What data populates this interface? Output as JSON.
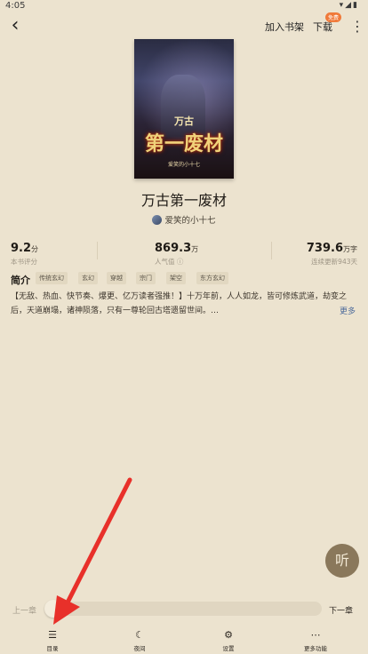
{
  "status_bar": {
    "time": "4:05",
    "icons": "▾◢▮"
  },
  "header": {
    "add_shelf": "加入书架",
    "download": "下载",
    "download_badge": "免费"
  },
  "book": {
    "cover_line1": "万古",
    "cover_line2": "第一废材",
    "cover_line3": "爱笑的小十七",
    "title": "万古第一废材",
    "author": "爱笑的小十七"
  },
  "stats": [
    {
      "value": "9.2",
      "unit": "分",
      "label": "本书评分"
    },
    {
      "value": "869.3",
      "unit": "万",
      "label": "人气值 ⓘ"
    },
    {
      "value": "739.6",
      "unit": "万字",
      "label": "连续更新943天"
    }
  ],
  "intro": {
    "label": "简介",
    "tags": [
      "传统玄幻",
      "玄幻",
      "穿越",
      "宗门",
      "架空",
      "东方玄幻"
    ],
    "text": "【无敌、热血、快节奏、爆更、亿万读者强推！】十万年前，人人如龙，皆可修炼武道，劫变之后，天道崩塌，诸神陨落，只有一尊轮回古塔遗留世间。…",
    "more": "更多"
  },
  "listen_button": "听",
  "progress": {
    "prev": "上一章",
    "next": "下一章",
    "value": 0
  },
  "bottom_nav": [
    {
      "icon": "☰",
      "label": "目录"
    },
    {
      "icon": "☾",
      "label": "夜间"
    },
    {
      "icon": "⚙",
      "label": "设置"
    },
    {
      "icon": "⋯",
      "label": "更多功能"
    }
  ],
  "colors": {
    "background": "#ece3cf",
    "accent": "#4d6b9b",
    "badge": "#f07a3a",
    "arrow": "#e8302a",
    "listen": "#8a785b"
  }
}
